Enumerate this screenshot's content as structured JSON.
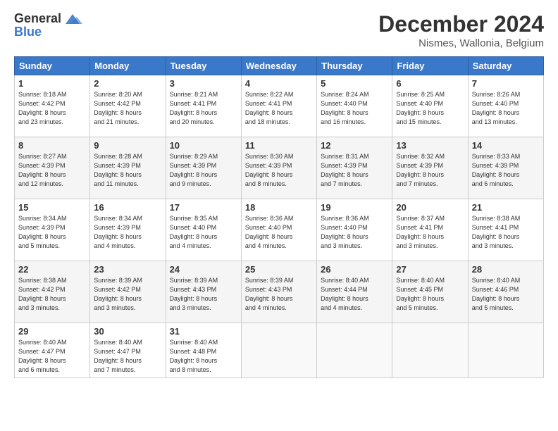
{
  "header": {
    "logo_line1": "General",
    "logo_line2": "Blue",
    "month": "December 2024",
    "location": "Nismes, Wallonia, Belgium"
  },
  "days_of_week": [
    "Sunday",
    "Monday",
    "Tuesday",
    "Wednesday",
    "Thursday",
    "Friday",
    "Saturday"
  ],
  "weeks": [
    [
      {
        "day": "1",
        "info": "Sunrise: 8:18 AM\nSunset: 4:42 PM\nDaylight: 8 hours\nand 23 minutes."
      },
      {
        "day": "2",
        "info": "Sunrise: 8:20 AM\nSunset: 4:42 PM\nDaylight: 8 hours\nand 21 minutes."
      },
      {
        "day": "3",
        "info": "Sunrise: 8:21 AM\nSunset: 4:41 PM\nDaylight: 8 hours\nand 20 minutes."
      },
      {
        "day": "4",
        "info": "Sunrise: 8:22 AM\nSunset: 4:41 PM\nDaylight: 8 hours\nand 18 minutes."
      },
      {
        "day": "5",
        "info": "Sunrise: 8:24 AM\nSunset: 4:40 PM\nDaylight: 8 hours\nand 16 minutes."
      },
      {
        "day": "6",
        "info": "Sunrise: 8:25 AM\nSunset: 4:40 PM\nDaylight: 8 hours\nand 15 minutes."
      },
      {
        "day": "7",
        "info": "Sunrise: 8:26 AM\nSunset: 4:40 PM\nDaylight: 8 hours\nand 13 minutes."
      }
    ],
    [
      {
        "day": "8",
        "info": "Sunrise: 8:27 AM\nSunset: 4:39 PM\nDaylight: 8 hours\nand 12 minutes."
      },
      {
        "day": "9",
        "info": "Sunrise: 8:28 AM\nSunset: 4:39 PM\nDaylight: 8 hours\nand 11 minutes."
      },
      {
        "day": "10",
        "info": "Sunrise: 8:29 AM\nSunset: 4:39 PM\nDaylight: 8 hours\nand 9 minutes."
      },
      {
        "day": "11",
        "info": "Sunrise: 8:30 AM\nSunset: 4:39 PM\nDaylight: 8 hours\nand 8 minutes."
      },
      {
        "day": "12",
        "info": "Sunrise: 8:31 AM\nSunset: 4:39 PM\nDaylight: 8 hours\nand 7 minutes."
      },
      {
        "day": "13",
        "info": "Sunrise: 8:32 AM\nSunset: 4:39 PM\nDaylight: 8 hours\nand 7 minutes."
      },
      {
        "day": "14",
        "info": "Sunrise: 8:33 AM\nSunset: 4:39 PM\nDaylight: 8 hours\nand 6 minutes."
      }
    ],
    [
      {
        "day": "15",
        "info": "Sunrise: 8:34 AM\nSunset: 4:39 PM\nDaylight: 8 hours\nand 5 minutes."
      },
      {
        "day": "16",
        "info": "Sunrise: 8:34 AM\nSunset: 4:39 PM\nDaylight: 8 hours\nand 4 minutes."
      },
      {
        "day": "17",
        "info": "Sunrise: 8:35 AM\nSunset: 4:40 PM\nDaylight: 8 hours\nand 4 minutes."
      },
      {
        "day": "18",
        "info": "Sunrise: 8:36 AM\nSunset: 4:40 PM\nDaylight: 8 hours\nand 4 minutes."
      },
      {
        "day": "19",
        "info": "Sunrise: 8:36 AM\nSunset: 4:40 PM\nDaylight: 8 hours\nand 3 minutes."
      },
      {
        "day": "20",
        "info": "Sunrise: 8:37 AM\nSunset: 4:41 PM\nDaylight: 8 hours\nand 3 minutes."
      },
      {
        "day": "21",
        "info": "Sunrise: 8:38 AM\nSunset: 4:41 PM\nDaylight: 8 hours\nand 3 minutes."
      }
    ],
    [
      {
        "day": "22",
        "info": "Sunrise: 8:38 AM\nSunset: 4:42 PM\nDaylight: 8 hours\nand 3 minutes."
      },
      {
        "day": "23",
        "info": "Sunrise: 8:39 AM\nSunset: 4:42 PM\nDaylight: 8 hours\nand 3 minutes."
      },
      {
        "day": "24",
        "info": "Sunrise: 8:39 AM\nSunset: 4:43 PM\nDaylight: 8 hours\nand 3 minutes."
      },
      {
        "day": "25",
        "info": "Sunrise: 8:39 AM\nSunset: 4:43 PM\nDaylight: 8 hours\nand 4 minutes."
      },
      {
        "day": "26",
        "info": "Sunrise: 8:40 AM\nSunset: 4:44 PM\nDaylight: 8 hours\nand 4 minutes."
      },
      {
        "day": "27",
        "info": "Sunrise: 8:40 AM\nSunset: 4:45 PM\nDaylight: 8 hours\nand 5 minutes."
      },
      {
        "day": "28",
        "info": "Sunrise: 8:40 AM\nSunset: 4:46 PM\nDaylight: 8 hours\nand 5 minutes."
      }
    ],
    [
      {
        "day": "29",
        "info": "Sunrise: 8:40 AM\nSunset: 4:47 PM\nDaylight: 8 hours\nand 6 minutes."
      },
      {
        "day": "30",
        "info": "Sunrise: 8:40 AM\nSunset: 4:47 PM\nDaylight: 8 hours\nand 7 minutes."
      },
      {
        "day": "31",
        "info": "Sunrise: 8:40 AM\nSunset: 4:48 PM\nDaylight: 8 hours\nand 8 minutes."
      },
      {
        "day": "",
        "info": ""
      },
      {
        "day": "",
        "info": ""
      },
      {
        "day": "",
        "info": ""
      },
      {
        "day": "",
        "info": ""
      }
    ]
  ]
}
